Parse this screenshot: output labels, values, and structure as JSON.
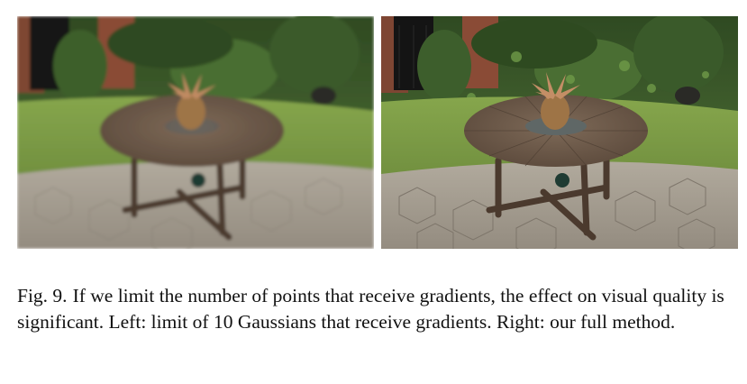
{
  "figure": {
    "panels": [
      {
        "id": "left",
        "variant": "limited",
        "description_color": "#6e7f4e"
      },
      {
        "id": "right",
        "variant": "full",
        "description_color": "#6e7f4e"
      }
    ]
  },
  "caption": {
    "label": "Fig. 9.",
    "text": "If we limit the number of points that receive gradients, the effect on visual quality is significant. Left: limit of 10 Gaussians that receive gradients. Right: our full method."
  },
  "colors": {
    "foliage_dark": "#3f5a2a",
    "grass": "#7c9a45",
    "table_wood": "#6d5847",
    "paving": "#a59f94",
    "brick": "#8a4b36"
  }
}
